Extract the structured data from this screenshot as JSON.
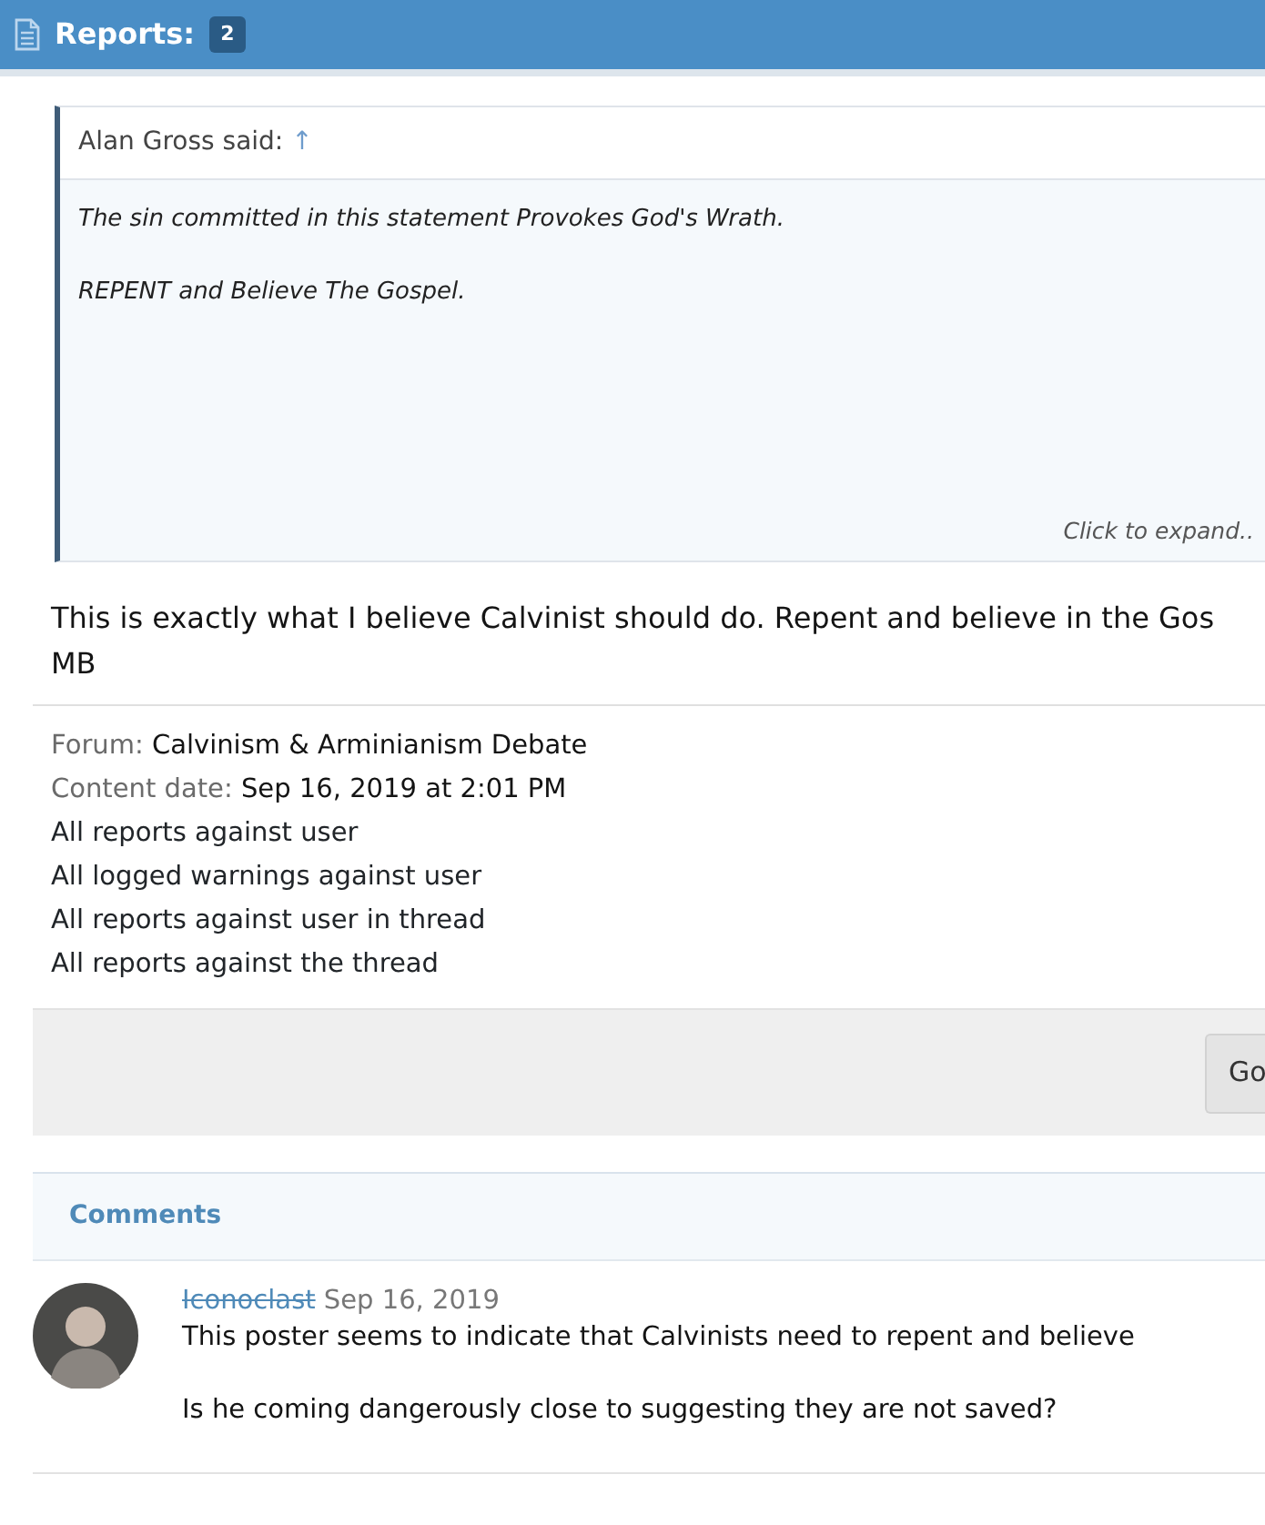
{
  "header": {
    "title": "Reports:",
    "count": "2"
  },
  "quote": {
    "author": "Alan Gross said:",
    "jump": "↑",
    "lines": [
      "The sin committed in this statement Provokes God's Wrath.",
      "REPENT and Believe The Gospel."
    ],
    "expand": "Click to expand.."
  },
  "message_lines": [
    "This is exactly what I believe Calvinist should do. Repent and believe in the Gos",
    "MB"
  ],
  "info": [
    {
      "label": "Forum:",
      "value": "Calvinism & Arminianism Debate"
    },
    {
      "label": "Content date:",
      "value": "Sep 16, 2019 at 2:01 PM"
    }
  ],
  "links": [
    "All reports against user",
    "All logged warnings against user",
    "All reports against user in thread",
    "All reports against the thread"
  ],
  "action_button": "Go",
  "comments": {
    "title": "Comments",
    "items": [
      {
        "author": "Iconoclast",
        "struck": true,
        "date": "Sep 16, 2019",
        "paragraphs": [
          "This poster seems to indicate that Calvinists need to repent and believe",
          "Is he coming dangerously close to suggesting they are not saved?"
        ]
      }
    ]
  }
}
